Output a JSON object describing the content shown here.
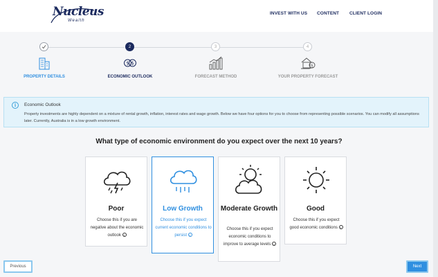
{
  "brand": {
    "name": "Nucleus",
    "sub": "Wealth"
  },
  "nav": [
    {
      "label": "INVEST WITH US"
    },
    {
      "label": "CONTENT"
    },
    {
      "label": "CLIENT LOGIN"
    }
  ],
  "steps": [
    {
      "number": "",
      "label": "PROPERTY DETAILS",
      "state": "done"
    },
    {
      "number": "2",
      "label": "ECONOMIC OUTLOOK",
      "state": "active"
    },
    {
      "number": "3",
      "label": "FORECAST METHOD",
      "state": "pending"
    },
    {
      "number": "4",
      "label": "YOUR PROPERTY FORECAST",
      "state": "pending"
    }
  ],
  "info": {
    "title": "Economic Outlook",
    "body": "Property investments are highly dependent on a mixture of rental growth, inflation, interest rates and wage growth. Below we have four options for you to choose from representing possible scenarios. You can modify all assumptions later. Currently, Australia is in a low growth environment."
  },
  "question": "What type of economic environment do you expect over the next 10 years?",
  "options": [
    {
      "title": "Poor",
      "icon": "storm-cloud-icon",
      "desc": "Choose this if you are negative about the economic outlook"
    },
    {
      "title": "Low Growth",
      "icon": "rain-cloud-icon",
      "desc": "Choose this if you expect current economic conditions to persist",
      "selected": true
    },
    {
      "title": "Moderate Growth",
      "icon": "sun-behind-cloud-icon",
      "desc": "Choose this if you expect economic conditions to improve to average levels"
    },
    {
      "title": "Good",
      "icon": "sun-icon",
      "desc": "Choose this if you expect good economic conditions"
    }
  ],
  "buttons": {
    "previous": "Previous",
    "next": "Next"
  },
  "colors": {
    "accent": "#2f8fe0",
    "navy": "#1b2a5e",
    "info_bg": "#e3f3fb"
  }
}
